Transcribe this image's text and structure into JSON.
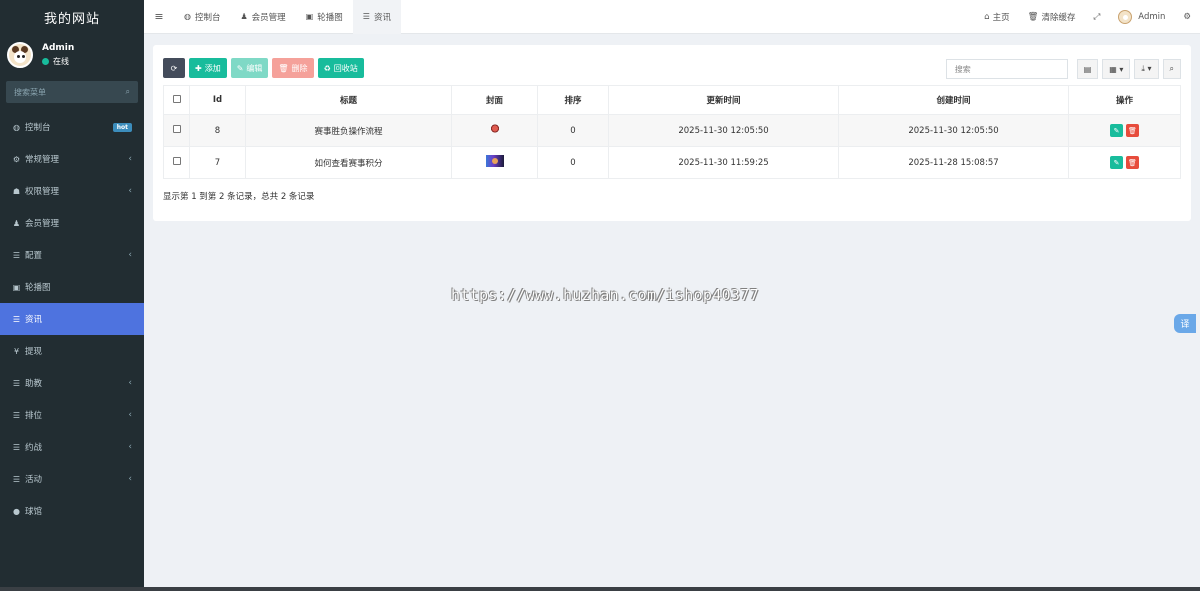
{
  "brand": "我的网站",
  "user": {
    "name": "Admin",
    "status": "在线"
  },
  "sidebar_search": {
    "placeholder": "搜索菜单"
  },
  "menu": [
    {
      "icon": "dashboard-icon",
      "glyph": "◍",
      "label": "控制台",
      "badge": "hot"
    },
    {
      "icon": "cogs-icon",
      "glyph": "⚙",
      "label": "常规管理",
      "arrow": "‹"
    },
    {
      "icon": "group-icon",
      "glyph": "☗",
      "label": "权限管理",
      "arrow": "‹"
    },
    {
      "icon": "user-icon",
      "glyph": "♟",
      "label": "会员管理"
    },
    {
      "icon": "list-icon",
      "glyph": "☰",
      "label": "配置",
      "arrow": "‹"
    },
    {
      "icon": "image-icon",
      "glyph": "▣",
      "label": "轮播图"
    },
    {
      "icon": "list-icon",
      "glyph": "☰",
      "label": "资讯",
      "active": true
    },
    {
      "icon": "yen-icon",
      "glyph": "¥",
      "label": "提现"
    },
    {
      "icon": "list-icon",
      "glyph": "☰",
      "label": "助教",
      "arrow": "‹"
    },
    {
      "icon": "list-icon",
      "glyph": "☰",
      "label": "排位",
      "arrow": "‹"
    },
    {
      "icon": "list-icon",
      "glyph": "☰",
      "label": "约战",
      "arrow": "‹"
    },
    {
      "icon": "list-icon",
      "glyph": "☰",
      "label": "活动",
      "arrow": "‹"
    },
    {
      "icon": "circle-icon",
      "glyph": "●",
      "label": "球馆"
    }
  ],
  "tabs": [
    {
      "icon": "dashboard-icon",
      "glyph": "◍",
      "label": "控制台"
    },
    {
      "icon": "user-icon",
      "glyph": "♟",
      "label": "会员管理"
    },
    {
      "icon": "image-icon",
      "glyph": "▣",
      "label": "轮播图"
    },
    {
      "icon": "list-icon",
      "glyph": "☰",
      "label": "资讯",
      "active": true
    }
  ],
  "top_right": {
    "home": "主页",
    "clear_cache": "清除缓存",
    "admin": "Admin"
  },
  "toolbar": {
    "add": "添加",
    "edit": "编辑",
    "delete": "删除",
    "recycle": "回收站",
    "search_placeholder": "搜索"
  },
  "table": {
    "headers": [
      "Id",
      "标题",
      "封面",
      "排序",
      "更新时间",
      "创建时间",
      "操作"
    ],
    "rows": [
      {
        "id": "8",
        "title": "赛事胜负操作流程",
        "sort": "0",
        "updated": "2025-11-30 12:05:50",
        "created": "2025-11-30 12:05:50"
      },
      {
        "id": "7",
        "title": "如何查看赛事积分",
        "sort": "0",
        "updated": "2025-11-30 11:59:25",
        "created": "2025-11-28 15:08:57"
      }
    ]
  },
  "pager_text": "显示第 1 到第 2 条记录，总共 2 条记录",
  "watermark": "https://www.huzhan.com/ishop40377",
  "translate_label": "译"
}
